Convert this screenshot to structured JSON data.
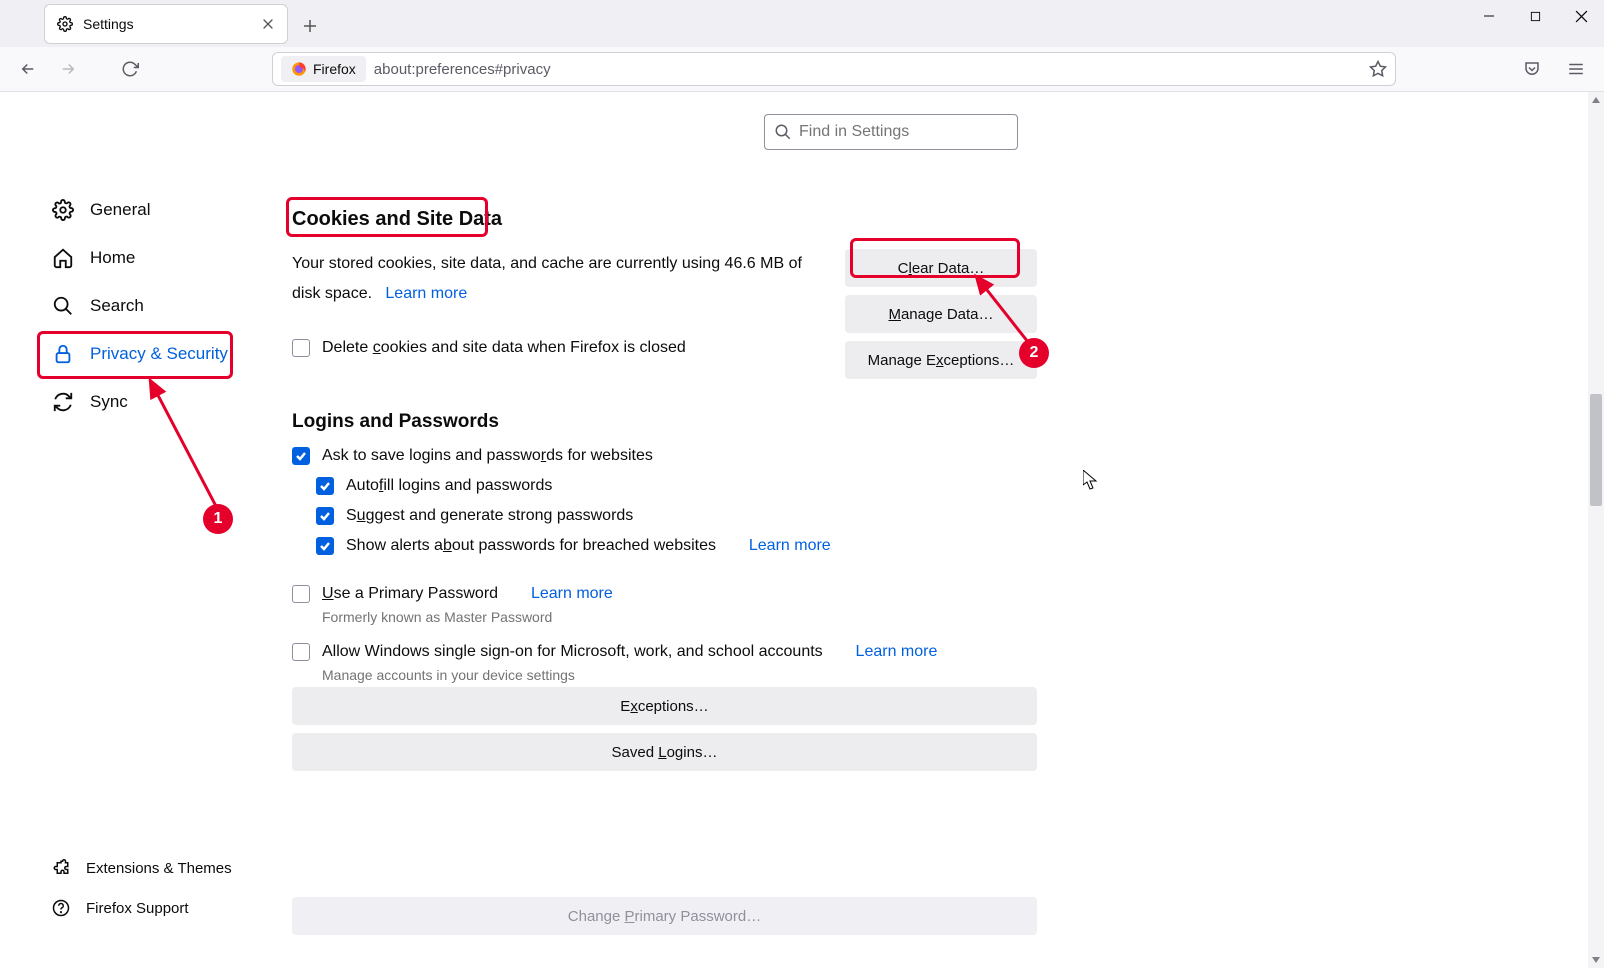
{
  "tab_title": "Settings",
  "url_label": "Firefox",
  "url": "about:preferences#privacy",
  "search_placeholder": "Find in Settings",
  "sidebar": [
    {
      "id": "general",
      "label": "General"
    },
    {
      "id": "home",
      "label": "Home"
    },
    {
      "id": "search",
      "label": "Search"
    },
    {
      "id": "privacy",
      "label": "Privacy & Security",
      "active": true
    },
    {
      "id": "sync",
      "label": "Sync"
    }
  ],
  "sidebar_bottom": [
    {
      "id": "ext",
      "label": "Extensions & Themes"
    },
    {
      "id": "support",
      "label": "Firefox Support"
    }
  ],
  "cookies": {
    "heading": "Cookies and Site Data",
    "desc_pre": "Your stored cookies, site data, and cache are currently using ",
    "size": "46.6 MB",
    "desc_post": " of disk space.",
    "learn_more": "Learn more",
    "delete_on_close": "Delete cookies and site data when Firefox is closed",
    "clear_data": "Clear Data…",
    "manage_data": "Manage Data…",
    "manage_exceptions": "Manage Exceptions…"
  },
  "logins": {
    "heading": "Logins and Passwords",
    "ask_save": "Ask to save logins and passwords for websites",
    "autofill": "Autofill logins and passwords",
    "suggest": "Suggest and generate strong passwords",
    "alerts": "Show alerts about passwords for breached websites",
    "learn_more": "Learn more",
    "primary": "Use a Primary Password",
    "primary_hint": "Formerly known as Master Password",
    "sso": "Allow Windows single sign-on for Microsoft, work, and school accounts",
    "sso_hint": "Manage accounts in your device settings",
    "exceptions": "Exceptions…",
    "saved_logins": "Saved Logins…",
    "change_primary": "Change Primary Password…"
  },
  "annotations": {
    "step1": "1",
    "step2": "2"
  }
}
